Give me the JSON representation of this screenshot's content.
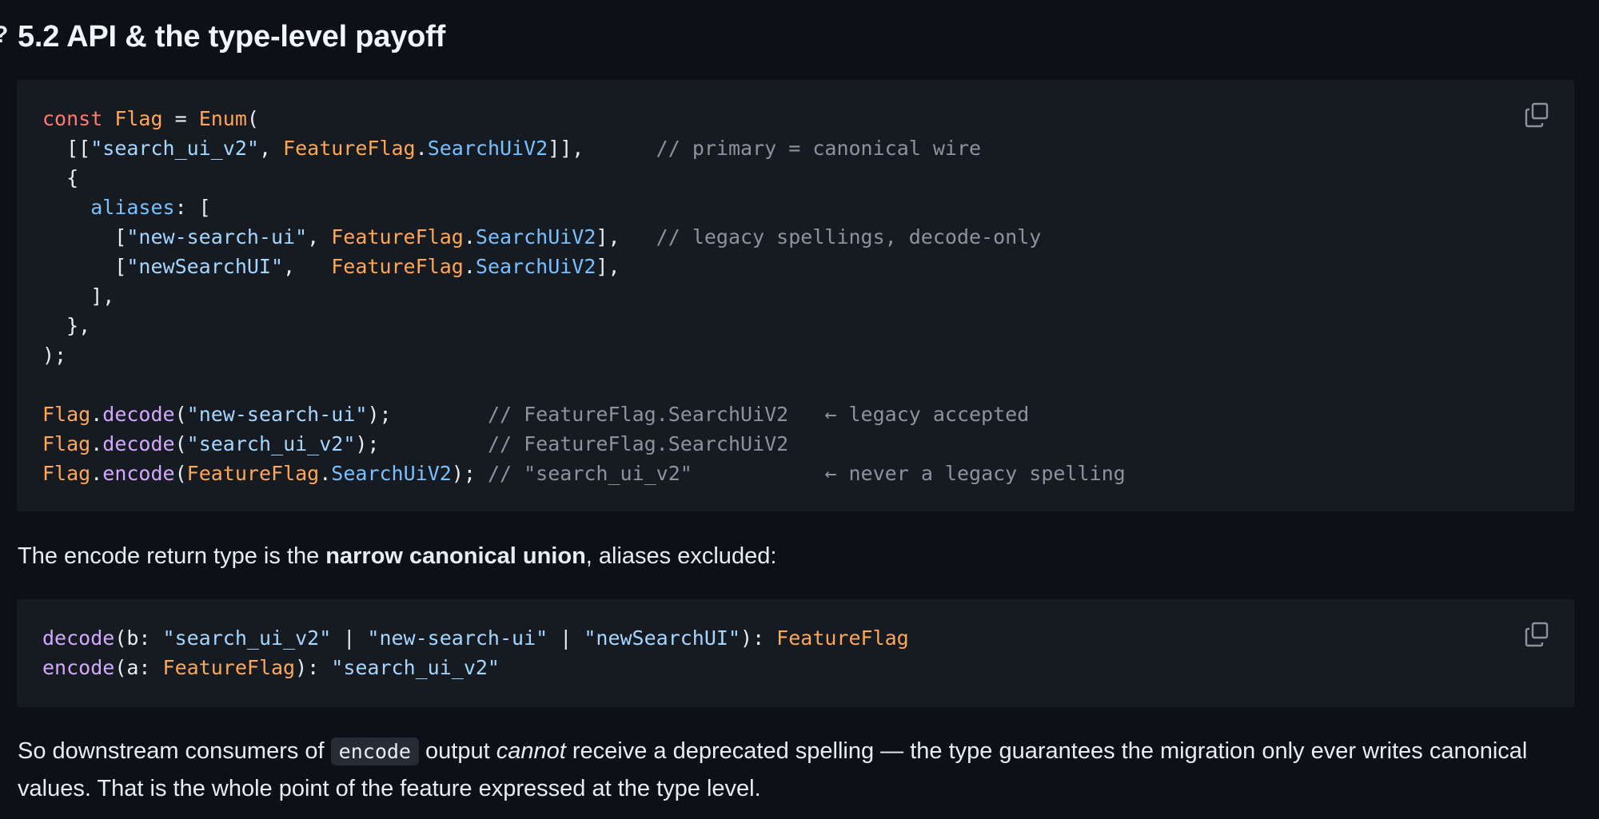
{
  "heading": {
    "anchor": "?",
    "title": "5.2 API & the type-level payoff"
  },
  "code_block_1": {
    "language": "typescript",
    "lines": [
      "const Flag = Enum(",
      "  [[\"search_ui_v2\", FeatureFlag.SearchUiV2]],      // primary = canonical wire",
      "  {",
      "    aliases: [",
      "      [\"new-search-ui\", FeatureFlag.SearchUiV2],   // legacy spellings, decode-only",
      "      [\"newSearchUI\",   FeatureFlag.SearchUiV2],",
      "    ],",
      "  },",
      ");",
      "",
      "Flag.decode(\"new-search-ui\");        // FeatureFlag.SearchUiV2   ← legacy accepted",
      "Flag.decode(\"search_ui_v2\");         // FeatureFlag.SearchUiV2",
      "Flag.encode(FeatureFlag.SearchUiV2); // \"search_ui_v2\"           ← never a legacy spelling"
    ]
  },
  "paragraph_1": {
    "before": "The encode return type is the ",
    "bold": "narrow canonical union",
    "after": ", aliases excluded:"
  },
  "code_block_2": {
    "language": "typescript",
    "lines": [
      "decode(b: \"search_ui_v2\" | \"new-search-ui\" | \"newSearchUI\"): FeatureFlag",
      "encode(a: FeatureFlag): \"search_ui_v2\""
    ]
  },
  "paragraph_2": {
    "before": "So downstream consumers of ",
    "code": "encode",
    "middle": " output ",
    "italic": "cannot",
    "after": " receive a deprecated spelling — the type guarantees the migration only ever writes canonical values. That is the whole point of the feature expressed at the type level."
  },
  "icons": {
    "copy": "copy-icon"
  },
  "colors": {
    "background": "#0d1117",
    "code_background": "#161b22",
    "keyword": "#ff7b72",
    "type": "#ffa657",
    "string": "#a5d6ff",
    "property": "#79c0ff",
    "function": "#d2a8ff",
    "comment": "#8b949e",
    "text": "#e6edf3"
  }
}
